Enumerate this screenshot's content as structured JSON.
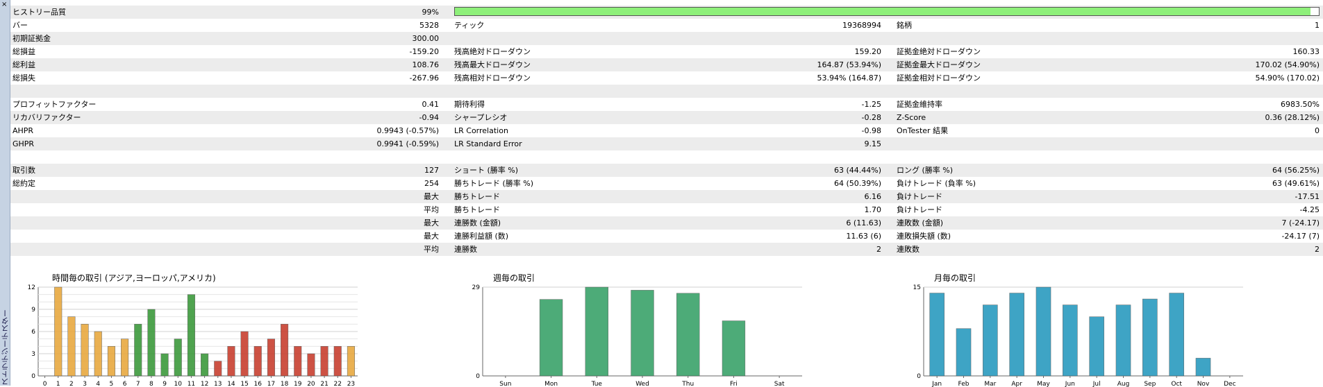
{
  "panel": {
    "close_icon": "×",
    "side_label": "ストラテジーテスター",
    "bg": "#ffffff",
    "stripe": "#ececec",
    "quality_fill_color": "#8ef07a",
    "quality_fraction": 0.99
  },
  "report": {
    "rows": [
      {
        "cells": [
          "ヒストリー品質",
          "99%",
          "",
          "",
          "",
          ""
        ]
      },
      {
        "cells": [
          "バー",
          "5328",
          "ティック",
          "19368994",
          "銘柄",
          "1"
        ]
      },
      {
        "cells": [
          "初期証拠金",
          "300.00",
          "",
          "",
          "",
          ""
        ]
      },
      {
        "cells": [
          "総損益",
          "-159.20",
          "残高絶対ドローダウン",
          "159.20",
          "証拠金絶対ドローダウン",
          "160.33"
        ]
      },
      {
        "cells": [
          "総利益",
          "108.76",
          "残高最大ドローダウン",
          "164.87 (53.94%)",
          "証拠金最大ドローダウン",
          "170.02 (54.90%)"
        ]
      },
      {
        "cells": [
          "総損失",
          "-267.96",
          "残高相対ドローダウン",
          "53.94% (164.87)",
          "証拠金相対ドローダウン",
          "54.90% (170.02)"
        ]
      },
      {
        "cells": [
          "",
          "",
          "",
          "",
          "",
          ""
        ]
      },
      {
        "cells": [
          "プロフィットファクター",
          "0.41",
          "期待利得",
          "-1.25",
          "証拠金維持率",
          "6983.50%"
        ]
      },
      {
        "cells": [
          "リカバリファクター",
          "-0.94",
          "シャープレシオ",
          "-0.28",
          "Z-Score",
          "0.36 (28.12%)"
        ]
      },
      {
        "cells": [
          "AHPR",
          "0.9943 (-0.57%)",
          "LR Correlation",
          "-0.98",
          "OnTester 結果",
          "0"
        ]
      },
      {
        "cells": [
          "GHPR",
          "0.9941 (-0.59%)",
          "LR Standard Error",
          "9.15",
          "",
          ""
        ]
      },
      {
        "cells": [
          "",
          "",
          "",
          "",
          "",
          ""
        ]
      },
      {
        "cells": [
          "取引数",
          "127",
          "ショート (勝率 %)",
          "63 (44.44%)",
          "ロング (勝率 %)",
          "64 (56.25%)"
        ]
      },
      {
        "cells": [
          "総約定",
          "254",
          "勝ちトレード (勝率 %)",
          "64 (50.39%)",
          "負けトレード (負率 %)",
          "63 (49.61%)"
        ]
      },
      {
        "cells": [
          "",
          "最大",
          "勝ちトレード",
          "6.16",
          "負けトレード",
          "-17.51"
        ]
      },
      {
        "cells": [
          "",
          "平均",
          "勝ちトレード",
          "1.70",
          "負けトレード",
          "-4.25"
        ]
      },
      {
        "cells": [
          "",
          "最大",
          "連勝数 (金額)",
          "6 (11.63)",
          "連敗数 (金額)",
          "7 (-24.17)"
        ]
      },
      {
        "cells": [
          "",
          "最大",
          "連勝利益額 (数)",
          "11.63 (6)",
          "連敗損失額 (数)",
          "-24.17 (7)"
        ]
      },
      {
        "cells": [
          "",
          "平均",
          "連勝数",
          "2",
          "連敗数",
          "2"
        ]
      },
      {
        "cells": [
          "",
          "",
          "",
          "",
          "",
          ""
        ]
      }
    ]
  },
  "chart_data": [
    {
      "type": "bar",
      "title": "時間毎の取引 (アジア,ヨーロッパ,アメリカ)",
      "categories": [
        "0",
        "1",
        "2",
        "3",
        "4",
        "5",
        "6",
        "7",
        "8",
        "9",
        "10",
        "11",
        "12",
        "13",
        "14",
        "15",
        "16",
        "17",
        "18",
        "19",
        "20",
        "21",
        "22",
        "23"
      ],
      "values": [
        0,
        12,
        8,
        7,
        6,
        4,
        5,
        7,
        9,
        3,
        5,
        11,
        3,
        2,
        4,
        6,
        4,
        5,
        7,
        4,
        3,
        4,
        4,
        4
      ],
      "ylim": [
        0,
        12
      ],
      "yticks": [
        "0",
        "3",
        "6",
        "9",
        "12"
      ],
      "colors": [
        "#e8a940",
        "#e8a940",
        "#e8a940",
        "#e8a940",
        "#e8a940",
        "#e8a940",
        "#e8a940",
        "#3c9a3c",
        "#3c9a3c",
        "#3c9a3c",
        "#3c9a3c",
        "#3c9a3c",
        "#3c9a3c",
        "#c84030",
        "#c84030",
        "#c84030",
        "#c84030",
        "#c84030",
        "#c84030",
        "#c84030",
        "#c84030",
        "#c84030",
        "#c84030",
        "#e8a940"
      ],
      "grid": true
    },
    {
      "type": "bar",
      "title": "週毎の取引",
      "categories": [
        "Sun",
        "Mon",
        "Tue",
        "Wed",
        "Thu",
        "Fri",
        "Sat"
      ],
      "values": [
        0,
        25,
        29,
        28,
        27,
        18,
        0
      ],
      "ylim": [
        0,
        29
      ],
      "yticks": [
        "0",
        "29"
      ],
      "colors": [
        "#3aa36a"
      ],
      "grid": true
    },
    {
      "type": "bar",
      "title": "月毎の取引",
      "categories": [
        "Jan",
        "Feb",
        "Mar",
        "Apr",
        "May",
        "Jun",
        "Jul",
        "Aug",
        "Sep",
        "Oct",
        "Nov",
        "Dec"
      ],
      "values": [
        14,
        8,
        12,
        14,
        15,
        12,
        10,
        12,
        13,
        14,
        3,
        0
      ],
      "ylim": [
        0,
        15
      ],
      "yticks": [
        "0",
        "15"
      ],
      "colors": [
        "#2a9bbf"
      ],
      "grid": true
    }
  ]
}
